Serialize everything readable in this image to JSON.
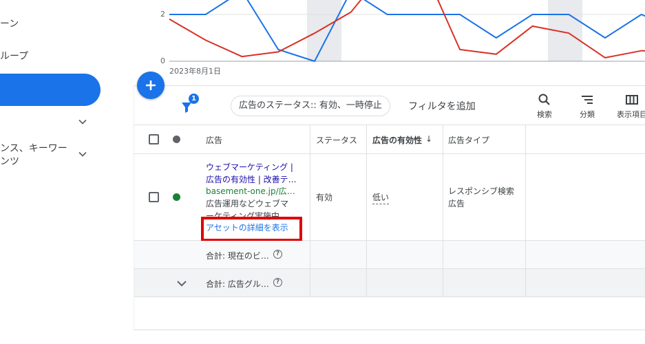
{
  "nav": {
    "items": [
      {
        "label": "ーン"
      },
      {
        "label": "ループ"
      }
    ],
    "expandable_1": "",
    "expandable_2_line1": "ンス、キーワー",
    "expandable_2_line2": "ンツ"
  },
  "chart": {
    "y_tick_top": "2",
    "y_tick_bottom": "0",
    "date_label": "2023年8月1日",
    "colors": {
      "blue": "#1a73e8",
      "red": "#d93025",
      "grid": "#e0e0e0",
      "shade": "#e8eaed"
    }
  },
  "chart_data": {
    "type": "line",
    "series": [
      {
        "values": [
          2,
          2,
          3,
          0.5,
          0,
          3,
          2,
          2,
          2,
          1,
          2,
          2,
          1,
          2,
          1.3
        ]
      },
      {
        "values": [
          1.8,
          0.9,
          0.2,
          0.4,
          1.2,
          2.1,
          4,
          4,
          0.5,
          0.3,
          1.5,
          1.2,
          0.15,
          0.45,
          0.4
        ]
      }
    ],
    "x_start_label": "2023年8月1日",
    "ylim": [
      0,
      2.5
    ]
  },
  "toolbar": {
    "filter_badge": "1",
    "status_chip": "広告のステータス:: 有効、一時停止",
    "add_filter": "フィルタを追加",
    "search_label": "検索",
    "segment_label": "分類",
    "columns_label": "表示項目"
  },
  "table": {
    "headers": {
      "ad": "広告",
      "status": "ステータス",
      "ad_strength": "広告の有効性",
      "sort_arrow": "↓",
      "ad_type": "広告タイプ"
    },
    "row": {
      "title": "ウェブマーケティング | 広告の有効性 | 改善テ…",
      "url": "basement-one.jp/広告…",
      "description": "広告運用などウェブマ ーケティング実施中…",
      "asset_link": "アセットの詳細を表示",
      "status": "有効",
      "ad_strength": "低い",
      "ad_type_line1": "レスポンシブ検索",
      "ad_type_line2": "広告",
      "status_color": "#188038"
    },
    "total_1": "合計: 現在のビ…",
    "total_2": "合計: 広告グル…",
    "help_glyph": "?"
  }
}
